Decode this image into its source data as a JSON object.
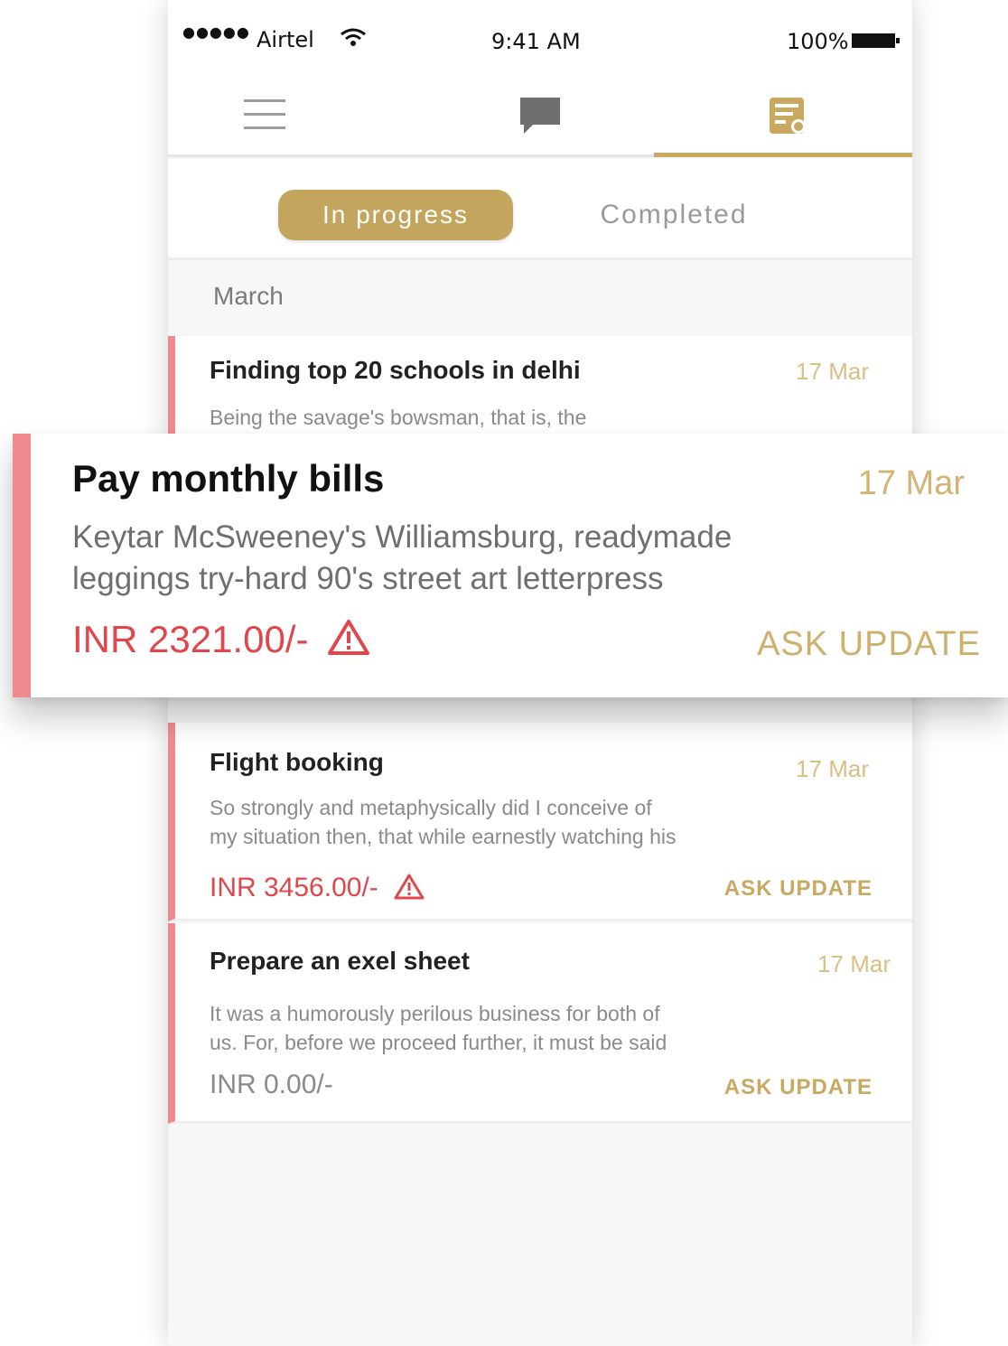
{
  "status_bar": {
    "signal": "●●●●●",
    "carrier": "Airtel",
    "time": "9:41 AM",
    "battery": "100%"
  },
  "nav": {
    "icons": [
      "menu-icon",
      "chat-icon",
      "tasks-icon"
    ],
    "active_tab_index": 2,
    "accent_color": "#c9a85f"
  },
  "segments": {
    "active": "In progress",
    "inactive": "Completed"
  },
  "section": {
    "month": "March"
  },
  "tasks": [
    {
      "title": "Finding top 20 schools in delhi",
      "date": "17 Mar",
      "description": "Being the savage's bowsman, that is, the"
    },
    {
      "title": "Pay monthly bills",
      "date": "17 Mar",
      "description_line1": "Keytar McSweeney's Williamsburg, readymade",
      "description_line2": "leggings try-hard 90's street art letterpress",
      "amount": "INR 2321.00/-",
      "action": "ASK UPDATE",
      "warning": true
    },
    {
      "title": "Flight booking",
      "date": "17 Mar",
      "description_line1": "So strongly and metaphysically did I conceive of",
      "description_line2": "my situation then, that while earnestly watching his",
      "amount": "INR 3456.00/-",
      "action": "ASK UPDATE",
      "warning": true
    },
    {
      "title": "Prepare an exel sheet",
      "date": "17 Mar",
      "description_line1": "It was a humorously perilous business for both of",
      "description_line2": "us. For, before we proceed further, it must be said",
      "amount": "INR 0.00/-",
      "action": "ASK UPDATE",
      "warning": false
    }
  ],
  "colors": {
    "gold": "#c9a85f",
    "alert_red": "#e0474d",
    "pink_bar": "#ef8b8f"
  }
}
